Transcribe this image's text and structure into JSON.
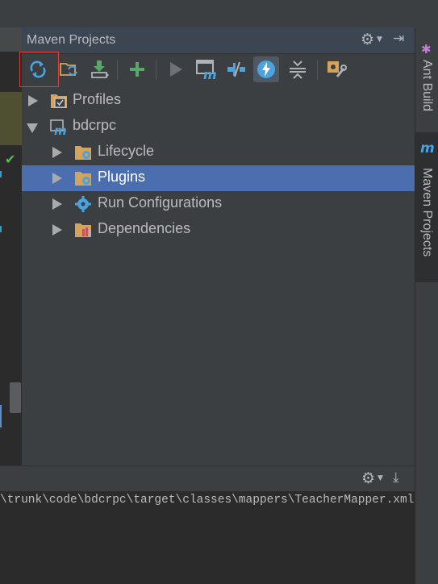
{
  "maven_panel": {
    "title": "Maven Projects",
    "toolbar": [
      {
        "name": "reimport-all-maven-projects-icon",
        "highlighted": true
      },
      {
        "name": "generate-sources-icon"
      },
      {
        "name": "download-sources-icon"
      },
      {
        "name": "add-maven-projects-icon"
      },
      {
        "name": "run-maven-build-icon"
      },
      {
        "name": "execute-maven-goal-icon"
      },
      {
        "name": "toggle-offline-mode-icon"
      },
      {
        "name": "toggle-skip-tests-icon",
        "active": true
      },
      {
        "name": "collapse-all-icon"
      },
      {
        "name": "maven-settings-icon"
      }
    ],
    "tree": {
      "profiles": "Profiles",
      "project": "bdcrpc",
      "lifecycle": "Lifecycle",
      "plugins": "Plugins",
      "run_configurations": "Run Configurations",
      "dependencies": "Dependencies",
      "selected": "Plugins"
    }
  },
  "right_strip": {
    "ant_build": "Ant Build",
    "maven_projects": "Maven Projects"
  },
  "console": {
    "line": "\\trunk\\code\\bdcrpc\\target\\classes\\mappers\\TeacherMapper.xml"
  },
  "colors": {
    "panel_bg": "#3c3f41",
    "selection": "#4b6eaf",
    "highlight_border": "#d9403a",
    "add_icon": "#59a869",
    "maven_accent": "#4aa3df"
  }
}
